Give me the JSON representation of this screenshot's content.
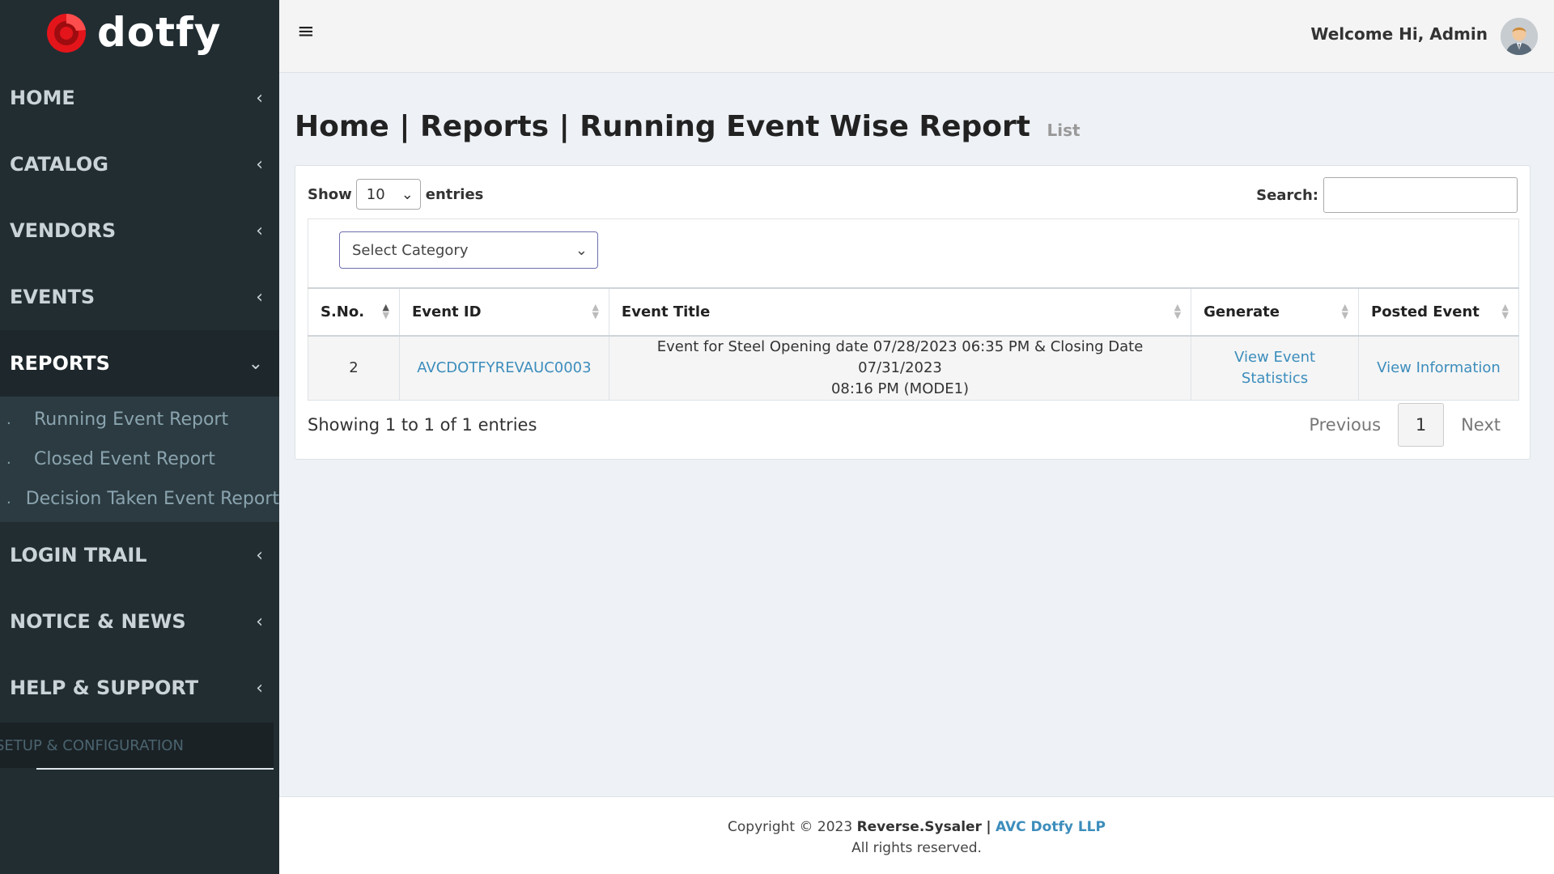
{
  "brand": {
    "name": "dotfy",
    "accent": "#e3151b"
  },
  "sidebar": {
    "items": [
      {
        "label": "HOME",
        "icon": "chevron-left-icon"
      },
      {
        "label": "CATALOG",
        "icon": "chevron-left-icon"
      },
      {
        "label": "VENDORS",
        "icon": "chevron-left-icon"
      },
      {
        "label": "EVENTS",
        "icon": "chevron-left-icon"
      },
      {
        "label": "REPORTS",
        "icon": "chevron-down-icon"
      },
      {
        "label": "LOGIN TRAIL",
        "icon": "chevron-left-icon"
      },
      {
        "label": "NOTICE & NEWS",
        "icon": "chevron-left-icon"
      },
      {
        "label": "HELP & SUPPORT",
        "icon": "chevron-left-icon"
      }
    ],
    "reports_submenu": [
      "Running Event Report",
      "Closed Event Report",
      "Decision Taken Event Report"
    ],
    "setup_label": "SETUP & CONFIGURATION"
  },
  "header": {
    "welcome": "Welcome Hi, Admin",
    "menu_icon": "hamburger-icon"
  },
  "page": {
    "title": "Home | Reports | Running Event Wise Report",
    "subtitle": "List"
  },
  "table_controls": {
    "show_label": "Show",
    "entries_label": "entries",
    "page_length": "10",
    "search_label": "Search:",
    "search_value": "",
    "category_placeholder": "Select Category"
  },
  "table": {
    "columns": [
      "S.No.",
      "Event ID",
      "Event Title",
      "Generate",
      "Posted Event"
    ],
    "rows": [
      {
        "sno": "2",
        "event_id": "AVCDOTFYREVAUC0003",
        "title_line1": "Event for Steel Opening date 07/28/2023 06:35 PM & Closing Date 07/31/2023",
        "title_line2": "08:16 PM (MODE1)",
        "generate": "View Event Statistics",
        "posted": "View Information"
      }
    ]
  },
  "pagination": {
    "info": "Showing 1 to 1 of 1 entries",
    "previous": "Previous",
    "current": "1",
    "next": "Next"
  },
  "footer": {
    "prefix": "Copyright © 2023",
    "brand": "Reverse.Sysaler",
    "separator": "|",
    "company": "AVC Dotfy LLP",
    "rights": "All rights reserved."
  }
}
